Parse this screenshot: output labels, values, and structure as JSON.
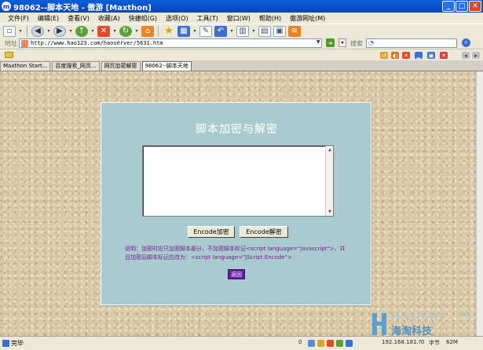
{
  "window": {
    "title": "98062--脚本天地 - 傲游 [Maxthon]",
    "buttons": [
      "_",
      "□",
      "✕"
    ]
  },
  "menu": {
    "items": [
      "文件(F)",
      "编辑(E)",
      "查看(V)",
      "收藏(A)",
      "快捷组(G)",
      "选项(O)",
      "工具(T)",
      "窗口(W)",
      "帮助(H)",
      "傲游网址(M)"
    ]
  },
  "addressbar": {
    "label": "地址",
    "url": "http://www.hao123.com/haoserver/5631.htm",
    "search_label": "搜索"
  },
  "tabs": [
    {
      "label": "Maxthon Start...",
      "active": false
    },
    {
      "label": "百度搜索_网页...",
      "active": false
    },
    {
      "label": "网页加密解密",
      "active": false
    },
    {
      "label": "98062--脚本天地",
      "active": true
    }
  ],
  "page": {
    "title": "脚本加密与解密",
    "textarea_value": "",
    "encode_label": "Encode加密",
    "decode_label": "Encode解密",
    "note_line1": "说明：加密时应只加密脚本部分，不加密脚本标记<script language=\"javascript\">，并",
    "note_line2": "且加密后脚本标记应改为：<script language=\"JScript.Encode\">",
    "back_label": "返回"
  },
  "watermark": {
    "en": "HAIDAO",
    "cn": "海淘科技",
    "blog": "Blog"
  },
  "status": {
    "text": "完毕",
    "count": "0",
    "ip": "192.168.181.?",
    "zero2": "0",
    "word": "字节",
    "mem": "62M"
  }
}
